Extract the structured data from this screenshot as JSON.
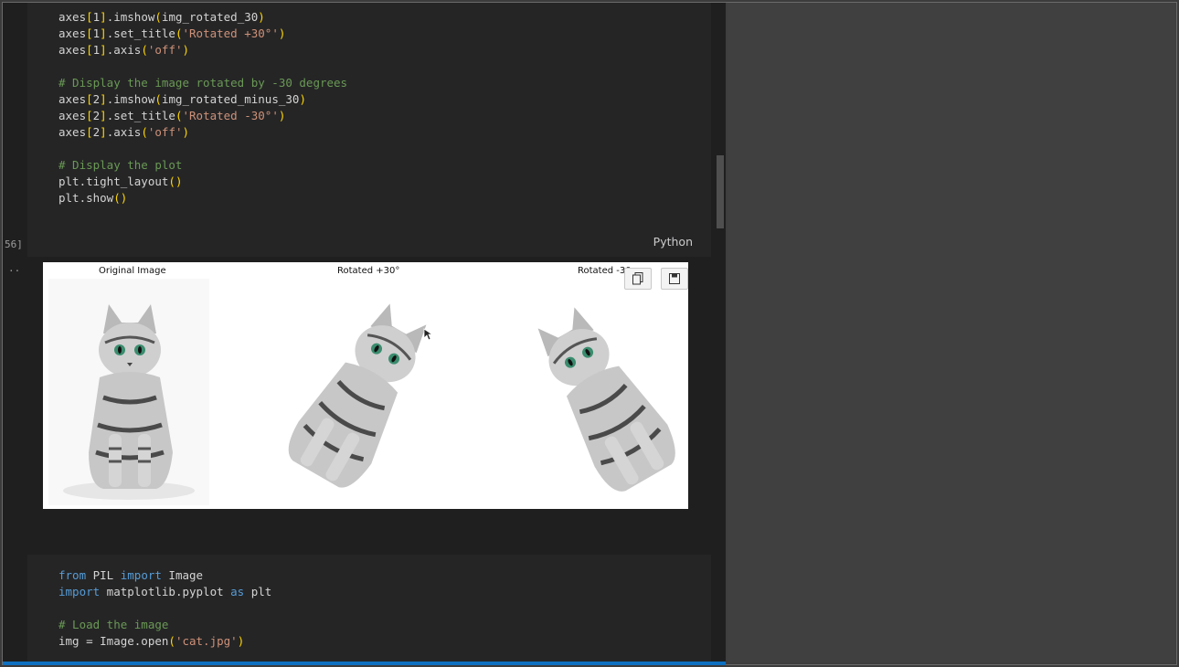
{
  "cell1": {
    "lines": [
      [
        {
          "t": "axes"
        },
        {
          "t": "[",
          "c": "pu"
        },
        {
          "t": "1"
        },
        {
          "t": "]",
          "c": "pu"
        },
        {
          "t": ".imshow"
        },
        {
          "t": "(",
          "c": "pu"
        },
        {
          "t": "img_rotated_30"
        },
        {
          "t": ")",
          "c": "pu"
        }
      ],
      [
        {
          "t": "axes"
        },
        {
          "t": "[",
          "c": "pu"
        },
        {
          "t": "1"
        },
        {
          "t": "]",
          "c": "pu"
        },
        {
          "t": ".set_title"
        },
        {
          "t": "(",
          "c": "pu"
        },
        {
          "t": "'Rotated +30°'",
          "c": "str"
        },
        {
          "t": ")",
          "c": "pu"
        }
      ],
      [
        {
          "t": "axes"
        },
        {
          "t": "[",
          "c": "pu"
        },
        {
          "t": "1"
        },
        {
          "t": "]",
          "c": "pu"
        },
        {
          "t": ".axis"
        },
        {
          "t": "(",
          "c": "pu"
        },
        {
          "t": "'off'",
          "c": "str"
        },
        {
          "t": ")",
          "c": "pu"
        }
      ],
      [],
      [
        {
          "t": "# Display the image rotated by -30 degrees",
          "c": "com"
        }
      ],
      [
        {
          "t": "axes"
        },
        {
          "t": "[",
          "c": "pu"
        },
        {
          "t": "2"
        },
        {
          "t": "]",
          "c": "pu"
        },
        {
          "t": ".imshow"
        },
        {
          "t": "(",
          "c": "pu"
        },
        {
          "t": "img_rotated_minus_30"
        },
        {
          "t": ")",
          "c": "pu"
        }
      ],
      [
        {
          "t": "axes"
        },
        {
          "t": "[",
          "c": "pu"
        },
        {
          "t": "2"
        },
        {
          "t": "]",
          "c": "pu"
        },
        {
          "t": ".set_title"
        },
        {
          "t": "(",
          "c": "pu"
        },
        {
          "t": "'Rotated -30°'",
          "c": "str"
        },
        {
          "t": ")",
          "c": "pu"
        }
      ],
      [
        {
          "t": "axes"
        },
        {
          "t": "[",
          "c": "pu"
        },
        {
          "t": "2"
        },
        {
          "t": "]",
          "c": "pu"
        },
        {
          "t": ".axis"
        },
        {
          "t": "(",
          "c": "pu"
        },
        {
          "t": "'off'",
          "c": "str"
        },
        {
          "t": ")",
          "c": "pu"
        }
      ],
      [],
      [
        {
          "t": "# Display the plot",
          "c": "com"
        }
      ],
      [
        {
          "t": "plt.tight_layout"
        },
        {
          "t": "()",
          "c": "pu"
        }
      ],
      [
        {
          "t": "plt.show"
        },
        {
          "t": "()",
          "c": "pu"
        }
      ]
    ],
    "exec_count": "56]",
    "language": "Python"
  },
  "output": {
    "dots": "..",
    "titles": [
      "Original Image",
      "Rotated +30°",
      "Rotated -30"
    ],
    "copy_icon": "copy-icon",
    "save_icon": "save-icon"
  },
  "cell2": {
    "lines": [
      [
        {
          "t": "from",
          "c": "kw"
        },
        {
          "t": " PIL "
        },
        {
          "t": "import",
          "c": "kw"
        },
        {
          "t": " Image"
        }
      ],
      [
        {
          "t": "import",
          "c": "kw"
        },
        {
          "t": " matplotlib.pyplot "
        },
        {
          "t": "as",
          "c": "kw"
        },
        {
          "t": " plt"
        }
      ],
      [],
      [
        {
          "t": "# Load the image",
          "c": "com"
        }
      ],
      [
        {
          "t": "img = Image.open"
        },
        {
          "t": "(",
          "c": "pu"
        },
        {
          "t": "'cat.jpg'",
          "c": "str"
        },
        {
          "t": ")",
          "c": "pu"
        }
      ]
    ]
  },
  "colors": {
    "comment": "#6a9955",
    "string": "#ce9178",
    "keyword": "#569cd6",
    "bracket": "#ffd700",
    "progress": "#0e70c0"
  }
}
